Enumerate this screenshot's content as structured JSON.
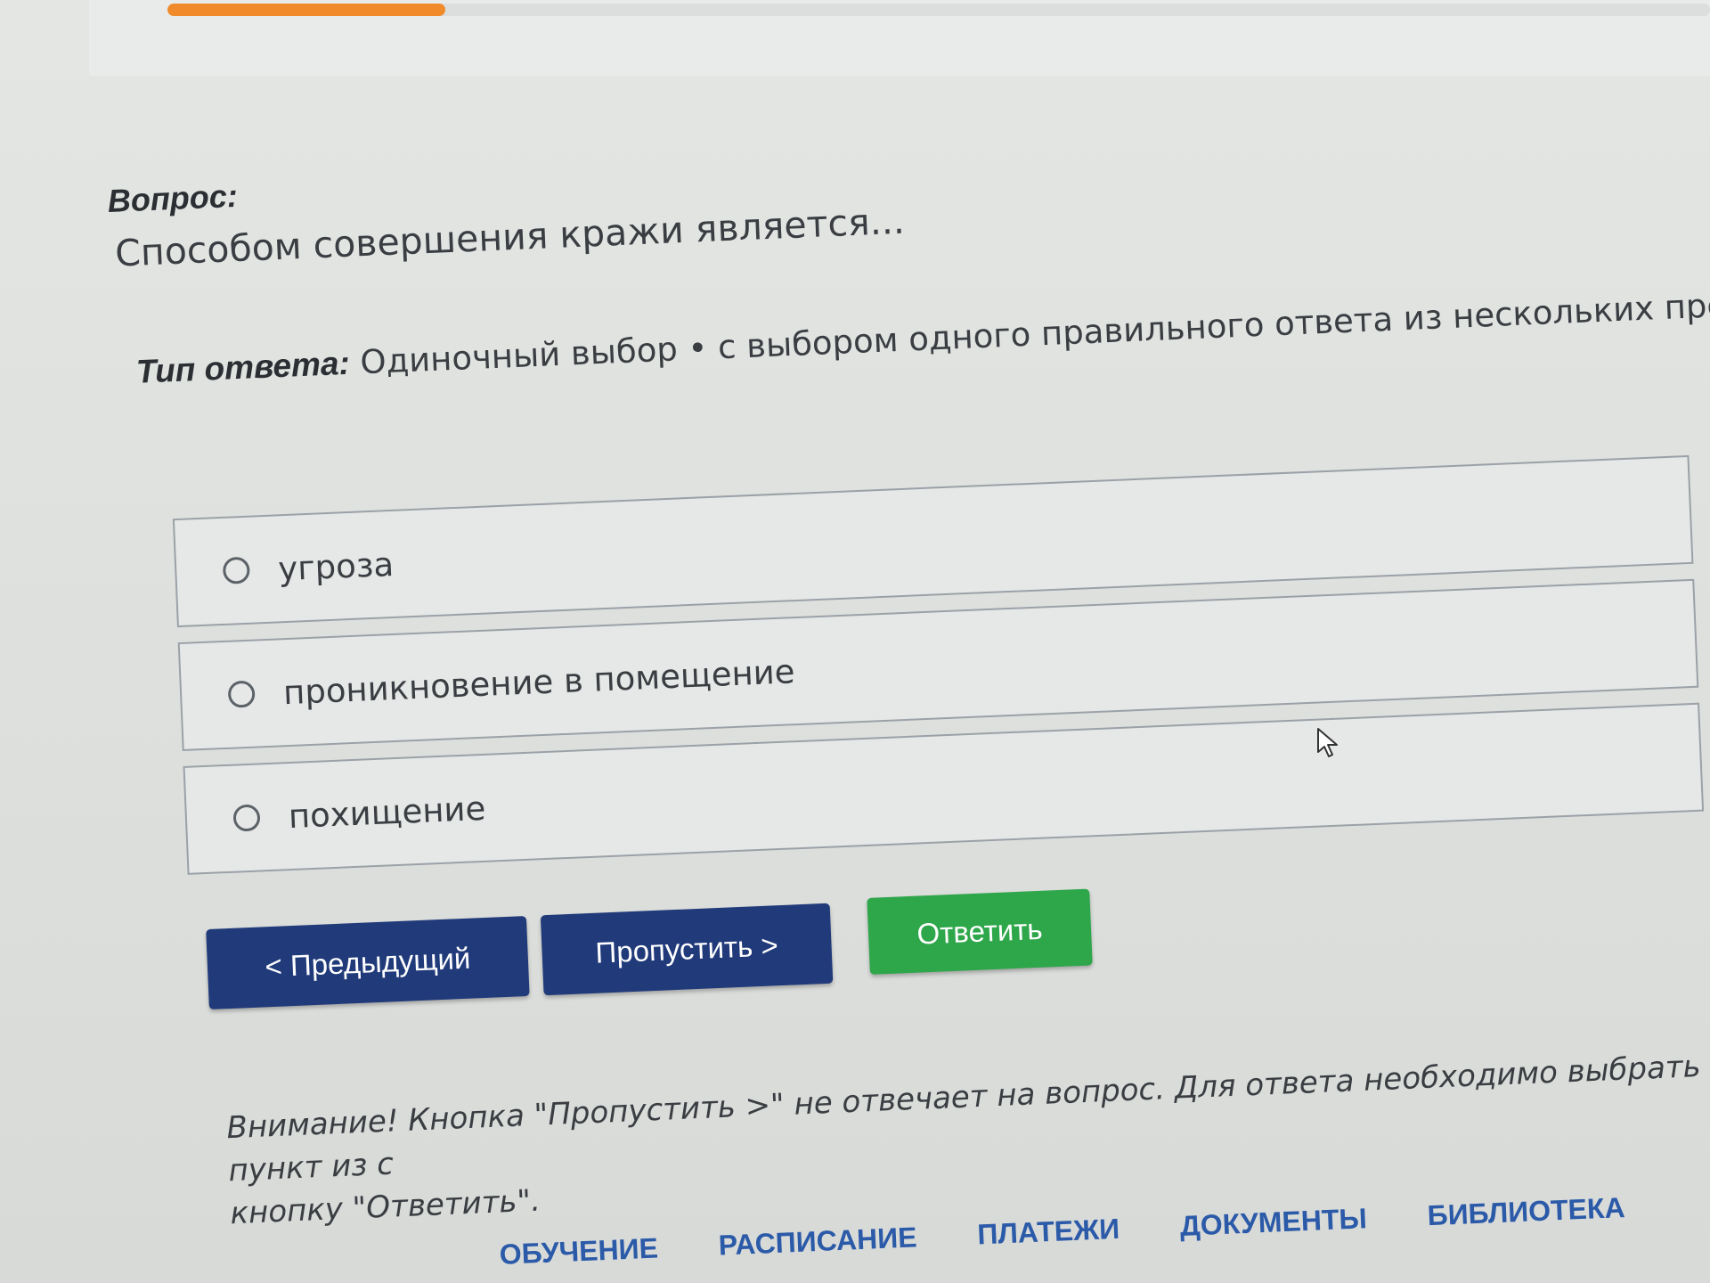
{
  "progress": {
    "value_percent": 18,
    "color": "#f08a2a"
  },
  "question": {
    "label": "Вопрос:",
    "text": "Способом совершения кражи является..."
  },
  "answer_type": {
    "label": "Тип ответа:",
    "value": "Одиночный выбор • с выбором одного правильного ответа из нескольких предложенных ва"
  },
  "options": [
    {
      "text": "угроза",
      "selected": false
    },
    {
      "text": "проникновение в помещение",
      "selected": false
    },
    {
      "text": "похищение",
      "selected": false
    }
  ],
  "buttons": {
    "prev_label": "< Предыдущий",
    "skip_label": "Пропустить >",
    "answer_label": "Ответить",
    "primary_color": "#203a7a",
    "answer_color": "#2ea64a"
  },
  "notice": {
    "line1": "Внимание! Кнопка \"Пропустить >\" не отвечает на вопрос. Для ответа необходимо выбрать пункт из с",
    "line2": "кнопку \"Ответить\"."
  },
  "nav": {
    "items": [
      "ОБУЧЕНИЕ",
      "РАСПИСАНИЕ",
      "ПЛАТЕЖИ",
      "ДОКУМЕНТЫ",
      "БИБЛИОТЕКА"
    ],
    "link_color": "#2b5aa8"
  }
}
